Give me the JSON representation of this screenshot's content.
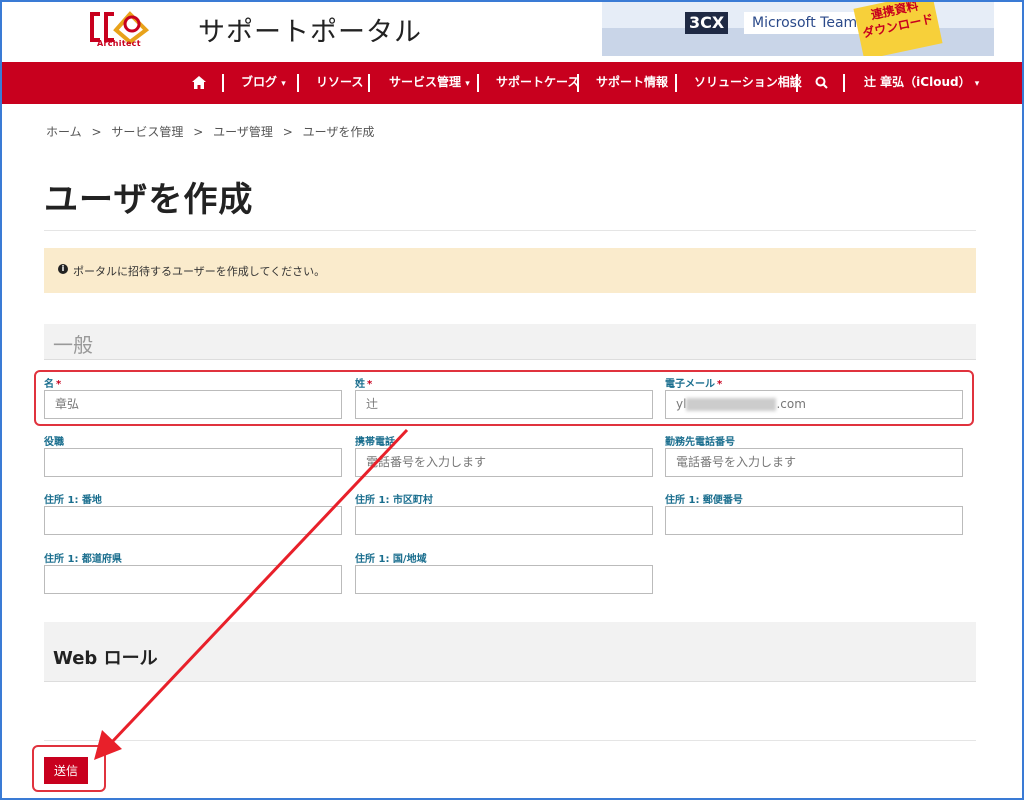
{
  "header": {
    "logo_text": "Architect",
    "site_title": "サポートポータル",
    "banner": {
      "cx": "3CX",
      "teams": "Microsoft Teams",
      "badge_line1": "連携資料",
      "badge_line2": "ダウンロード"
    }
  },
  "nav": {
    "home": "ホーム",
    "items": [
      "ブログ",
      "リソース",
      "サービス管理",
      "サポートケース",
      "サポート情報",
      "ソリューション相談"
    ],
    "user": "辻 章弘（iCloud）",
    "caret": "▾"
  },
  "breadcrumb": [
    "ホーム",
    ">",
    "サービス管理",
    ">",
    "ユーザ管理",
    ">",
    "ユーザを作成"
  ],
  "page_title": "ユーザを作成",
  "notice": "ポータルに招待するユーザーを作成してください。",
  "section_general": "一般",
  "fields": {
    "first_name": {
      "label": "名",
      "required": "*",
      "value": "章弘"
    },
    "last_name": {
      "label": "姓",
      "required": "*",
      "value": "辻"
    },
    "email": {
      "label": "電子メール",
      "required": "*",
      "value_prefix": "yl",
      "value_suffix": ".com"
    },
    "job_title": {
      "label": "役職",
      "value": ""
    },
    "mobile_phone": {
      "label": "携帯電話",
      "placeholder": "電話番号を入力します"
    },
    "work_phone": {
      "label": "勤務先電話番号",
      "placeholder": "電話番号を入力します"
    },
    "street": {
      "label": "住所 1: 番地",
      "value": ""
    },
    "city": {
      "label": "住所 1: 市区町村",
      "value": ""
    },
    "postal_code": {
      "label": "住所 1: 郵便番号",
      "value": ""
    },
    "state": {
      "label": "住所 1: 都道府県",
      "value": ""
    },
    "country": {
      "label": "住所 1: 国/地域",
      "value": ""
    }
  },
  "section_web_role": "Web ロール",
  "submit_label": "送信",
  "colors": {
    "brand_red": "#c8001e",
    "notice_bg": "#faebcc",
    "label_teal": "#1a6e8e",
    "annotation_red": "#e0323d"
  }
}
